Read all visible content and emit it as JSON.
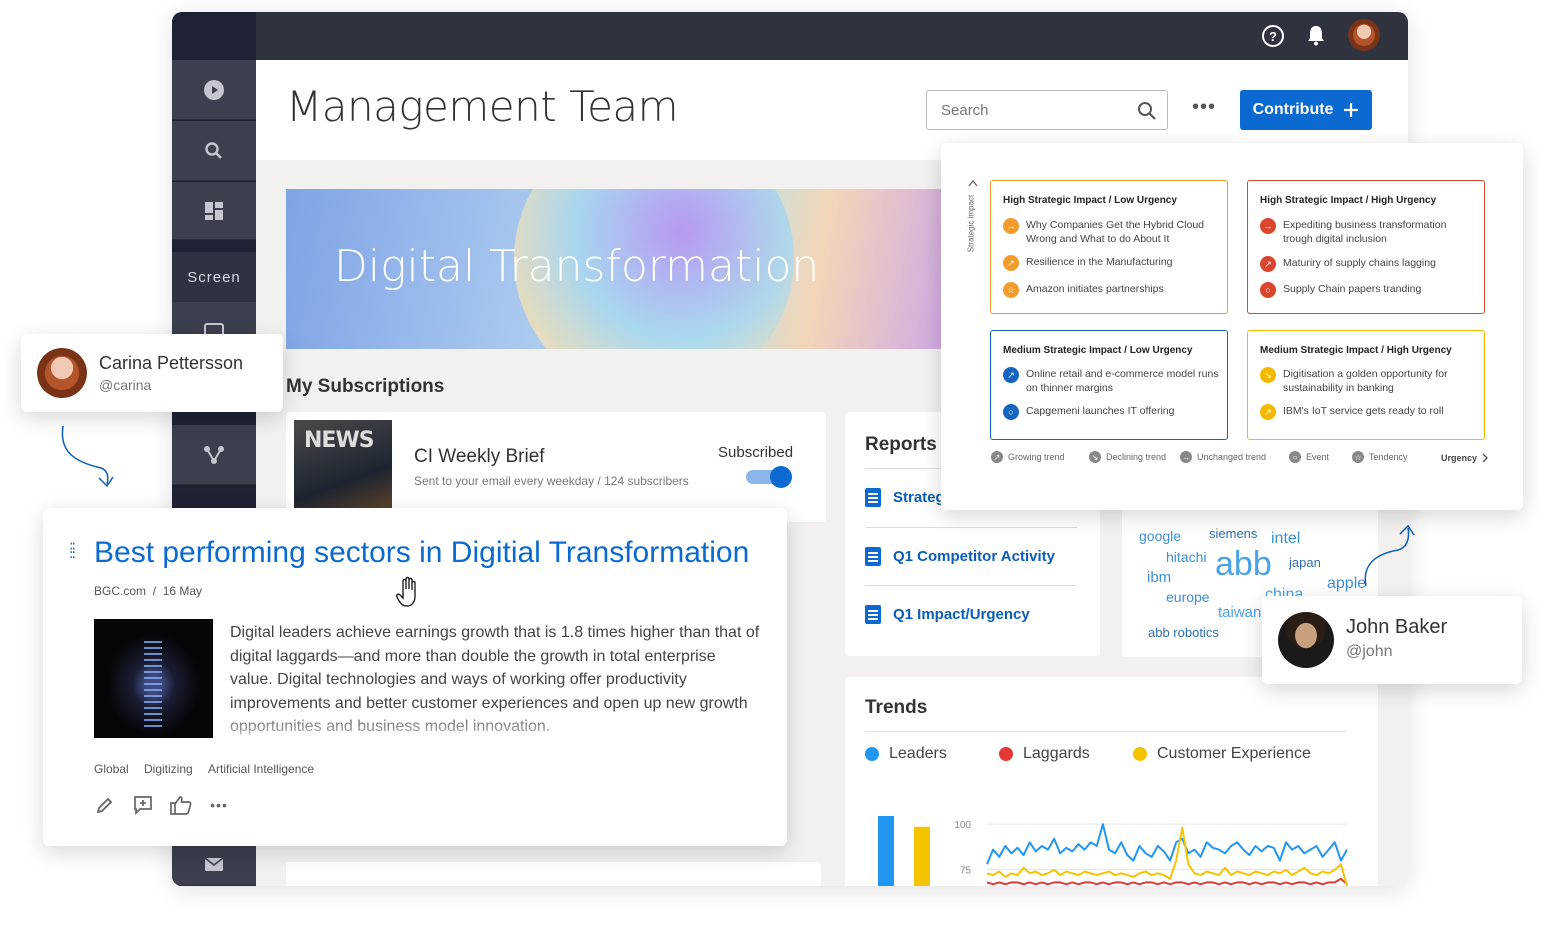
{
  "header": {
    "title": "Management Team",
    "search_placeholder": "Search",
    "more_label": "•••",
    "contribute_label": "Contribute"
  },
  "sidebar": {
    "screen_label": "Screen"
  },
  "hero": {
    "title": "Digital Transformation"
  },
  "subscriptions": {
    "heading": "My Subscriptions",
    "thumb_text": "NEWS",
    "item_name": "CI Weekly Brief",
    "item_meta": "Sent to your email every weekday  /  124 subscribers",
    "status": "Subscribed"
  },
  "reports": {
    "title": "Reports",
    "items": [
      "Strateg",
      "Q1 Competitor Activity",
      "Q1 Impact/Urgency"
    ]
  },
  "word_cloud": {
    "words": [
      "google",
      "siemens",
      "intel",
      "hitachi",
      "abb",
      "ibm",
      "japan",
      "apple",
      "europe",
      "china",
      "taiwan",
      "abb robotics"
    ]
  },
  "trends": {
    "title": "Trends",
    "legend": [
      {
        "label": "Leaders",
        "color": "#2196f3"
      },
      {
        "label": "Laggards",
        "color": "#e53935"
      },
      {
        "label": "Customer Experience",
        "color": "#f5c400"
      }
    ],
    "y_ticks": [
      "100",
      "75"
    ]
  },
  "chart_data": {
    "type": "line",
    "title": "",
    "ylim": [
      60,
      105
    ],
    "x": [
      1,
      2,
      3,
      4,
      5,
      6,
      7,
      8,
      9,
      10,
      11,
      12,
      13,
      14,
      15,
      16,
      17,
      18,
      19,
      20,
      21,
      22,
      23,
      24,
      25,
      26,
      27,
      28,
      29,
      30,
      31,
      32,
      33,
      34,
      35,
      36,
      37,
      38,
      39,
      40,
      41,
      42,
      43,
      44,
      45,
      46,
      47,
      48,
      49,
      50,
      51,
      52,
      53,
      54,
      55,
      56,
      57,
      58,
      59,
      60
    ],
    "series": [
      {
        "name": "Leaders",
        "values": [
          78,
          86,
          82,
          88,
          84,
          87,
          83,
          90,
          85,
          88,
          86,
          92,
          84,
          87,
          85,
          89,
          86,
          90,
          88,
          100,
          86,
          84,
          90,
          83,
          80,
          88,
          84,
          82,
          88,
          85,
          80,
          90,
          92,
          84,
          86,
          82,
          90,
          87,
          86,
          84,
          88,
          90,
          86,
          83,
          88,
          85,
          88,
          87,
          80,
          90,
          86,
          88,
          84,
          86,
          88,
          82,
          86,
          90,
          80,
          86
        ]
      },
      {
        "name": "Laggards",
        "values": [
          68,
          67,
          68,
          67,
          68,
          68,
          67,
          68,
          67,
          68,
          67,
          68,
          68,
          67,
          68,
          67,
          68,
          68,
          67,
          68,
          67,
          68,
          68,
          67,
          68,
          67,
          68,
          68,
          67,
          68,
          67,
          68,
          68,
          67,
          68,
          67,
          68,
          68,
          67,
          68,
          67,
          68,
          68,
          67,
          68,
          67,
          68,
          68,
          67,
          68,
          67,
          68,
          68,
          67,
          68,
          67,
          68,
          68,
          70,
          67
        ]
      },
      {
        "name": "Customer Experience",
        "values": [
          73,
          72,
          74,
          71,
          73,
          72,
          76,
          73,
          74,
          72,
          73,
          75,
          72,
          74,
          73,
          72,
          74,
          73,
          72,
          73,
          74,
          72,
          73,
          72,
          71,
          73,
          74,
          72,
          73,
          72,
          70,
          80,
          98,
          78,
          73,
          72,
          74,
          73,
          72,
          76,
          72,
          74,
          73,
          72,
          74,
          73,
          72,
          74,
          73,
          75,
          72,
          74,
          76,
          73,
          72,
          74,
          73,
          75,
          78,
          66
        ]
      }
    ],
    "bars": [
      {
        "series": "Leaders",
        "value": 90
      },
      {
        "series": "Customer Experience",
        "value": 78
      }
    ]
  },
  "users": {
    "carina": {
      "name": "Carina Pettersson",
      "handle": "@carina"
    },
    "john": {
      "name": "John Baker",
      "handle": "@john"
    }
  },
  "article": {
    "title": "Best performing sectors in Digitial Transformation",
    "source": "BGC.com",
    "date": "16 May",
    "body": "Digital leaders achieve earnings growth that is 1.8 times higher than that of digital laggards—and more than double the growth in total enterprise value. Digital technologies and ways of working offer productivity improvements and better customer experiences and open up new growth opportunities and business model innovation.",
    "tags": [
      "Global",
      "Digitizing",
      "Artificial Intelligence"
    ]
  },
  "matrix": {
    "y_axis_label": "Strategic impact",
    "x_axis_label": "Urgency",
    "quadrants": [
      {
        "title": "High Strategic Impact / Low Urgency",
        "color": "#f39c2e",
        "items": [
          {
            "text": "Why Companies Get the Hybrid Cloud Wrong and What to do About It",
            "icon": "arrow-right-icon",
            "glyph": "→"
          },
          {
            "text": "Resilience in the Manufacturing",
            "icon": "arrow-up-right-icon",
            "glyph": "↗"
          },
          {
            "text": "Amazon initiates partnerships",
            "icon": "star-icon",
            "glyph": "☆"
          }
        ]
      },
      {
        "title": "High Strategic Impact / High Urgency",
        "color": "#d9452d",
        "items": [
          {
            "text": "Expediting business transformation trough digital inclusion",
            "icon": "arrow-right-icon",
            "glyph": "→"
          },
          {
            "text": "Maturiry of supply chains lagging",
            "icon": "arrow-up-right-icon",
            "glyph": "↗"
          },
          {
            "text": "Supply Chain papers tranding",
            "icon": "circle-icon",
            "glyph": "○"
          }
        ]
      },
      {
        "title": "Medium Strategic Impact / Low Urgency",
        "color": "#1565c0",
        "items": [
          {
            "text": "Online retail and e-commerce model runs on thinner margins",
            "icon": "arrow-up-right-icon",
            "glyph": "↗"
          },
          {
            "text": "Capgemeni launches IT offering",
            "icon": "circle-icon",
            "glyph": "○"
          }
        ]
      },
      {
        "title": "Medium Strategic Impact / High Urgency",
        "color": "#f5b800",
        "items": [
          {
            "text": "Digitisation a golden opportunity for sustainability in banking",
            "icon": "arrow-down-right-icon",
            "glyph": "↘"
          },
          {
            "text": "IBM's IoT service gets ready to roll",
            "icon": "arrow-up-right-icon",
            "glyph": "↗"
          }
        ]
      }
    ],
    "legend": [
      "Growing trend",
      "Declining trend",
      "Unchanged trend",
      "Event",
      "Tendency"
    ]
  }
}
